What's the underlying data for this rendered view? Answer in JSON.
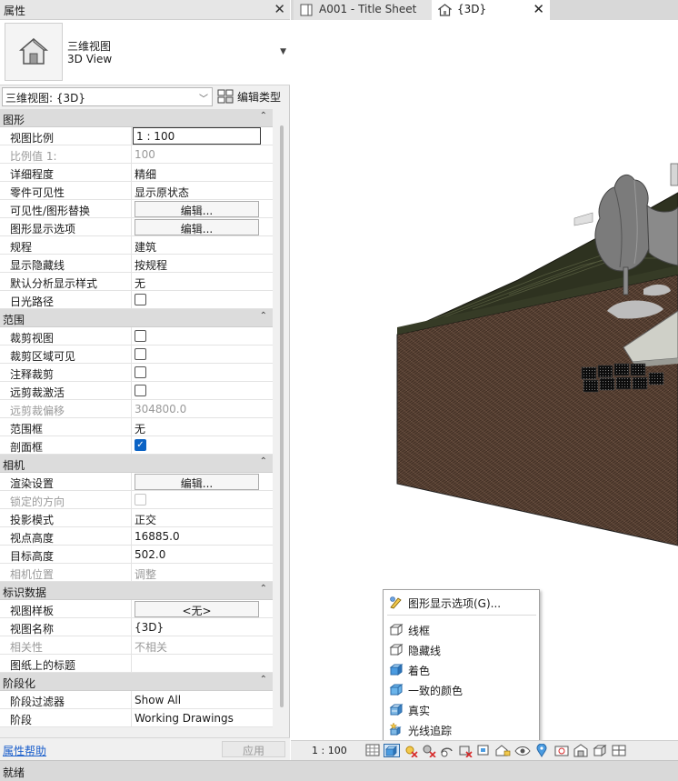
{
  "palette": {
    "title": "属性",
    "type_name_zh": "三维视图",
    "type_name_en": "3D View",
    "instance": "三维视图: {3D}",
    "edit_type": "编辑类型",
    "help": "属性帮助",
    "apply": "应用"
  },
  "sections": [
    {
      "title": "图形",
      "rows": [
        {
          "name": "视图比例",
          "value": "1 : 100"
        },
        {
          "name": "比例值 1:",
          "value": "100"
        },
        {
          "name": "详细程度",
          "value": "精细"
        },
        {
          "name": "零件可见性",
          "value": "显示原状态"
        },
        {
          "name": "可见性/图形替换",
          "value": "编辑..."
        },
        {
          "name": "图形显示选项",
          "value": "编辑..."
        },
        {
          "name": "规程",
          "value": "建筑"
        },
        {
          "name": "显示隐藏线",
          "value": "按规程"
        },
        {
          "name": "默认分析显示样式",
          "value": "无"
        },
        {
          "name": "日光路径",
          "value": ""
        }
      ]
    },
    {
      "title": "范围",
      "rows": [
        {
          "name": "裁剪视图",
          "value": ""
        },
        {
          "name": "裁剪区域可见",
          "value": ""
        },
        {
          "name": "注释裁剪",
          "value": ""
        },
        {
          "name": "远剪裁激活",
          "value": ""
        },
        {
          "name": "远剪裁偏移",
          "value": "304800.0"
        },
        {
          "name": "范围框",
          "value": "无"
        },
        {
          "name": "剖面框",
          "value": ""
        }
      ]
    },
    {
      "title": "相机",
      "rows": [
        {
          "name": "渲染设置",
          "value": "编辑..."
        },
        {
          "name": "锁定的方向",
          "value": ""
        },
        {
          "name": "投影模式",
          "value": "正交"
        },
        {
          "name": "视点高度",
          "value": "16885.0"
        },
        {
          "name": "目标高度",
          "value": "502.0"
        },
        {
          "name": "相机位置",
          "value": "调整"
        }
      ]
    },
    {
      "title": "标识数据",
      "rows": [
        {
          "name": "视图样板",
          "value": "<无>"
        },
        {
          "name": "视图名称",
          "value": "{3D}"
        },
        {
          "name": "相关性",
          "value": "不相关"
        },
        {
          "name": "图纸上的标题",
          "value": ""
        }
      ]
    },
    {
      "title": "阶段化",
      "rows": [
        {
          "name": "阶段过滤器",
          "value": "Show All"
        },
        {
          "name": "阶段",
          "value": "Working Drawings"
        }
      ]
    }
  ],
  "tabs": [
    {
      "label": "A001 - Title Sheet"
    },
    {
      "label": "{3D}"
    }
  ],
  "context_menu": [
    {
      "label": "图形显示选项(G)...",
      "icon": "graphic-display-icon"
    },
    {
      "label": "线框",
      "icon": "wireframe-icon"
    },
    {
      "label": "隐藏线",
      "icon": "hidden-line-icon"
    },
    {
      "label": "着色",
      "icon": "shaded-icon"
    },
    {
      "label": "一致的颜色",
      "icon": "consistent-colors-icon"
    },
    {
      "label": "真实",
      "icon": "realistic-icon"
    },
    {
      "label": "光线追踪",
      "icon": "ray-trace-icon"
    }
  ],
  "view_control": {
    "scale": "1 : 100"
  },
  "status": "就绪",
  "colors": {
    "terrain": "#2e3220",
    "soil": "#5a4335",
    "checkbox_on": "#0b63c5",
    "link": "#1a5ecb"
  }
}
